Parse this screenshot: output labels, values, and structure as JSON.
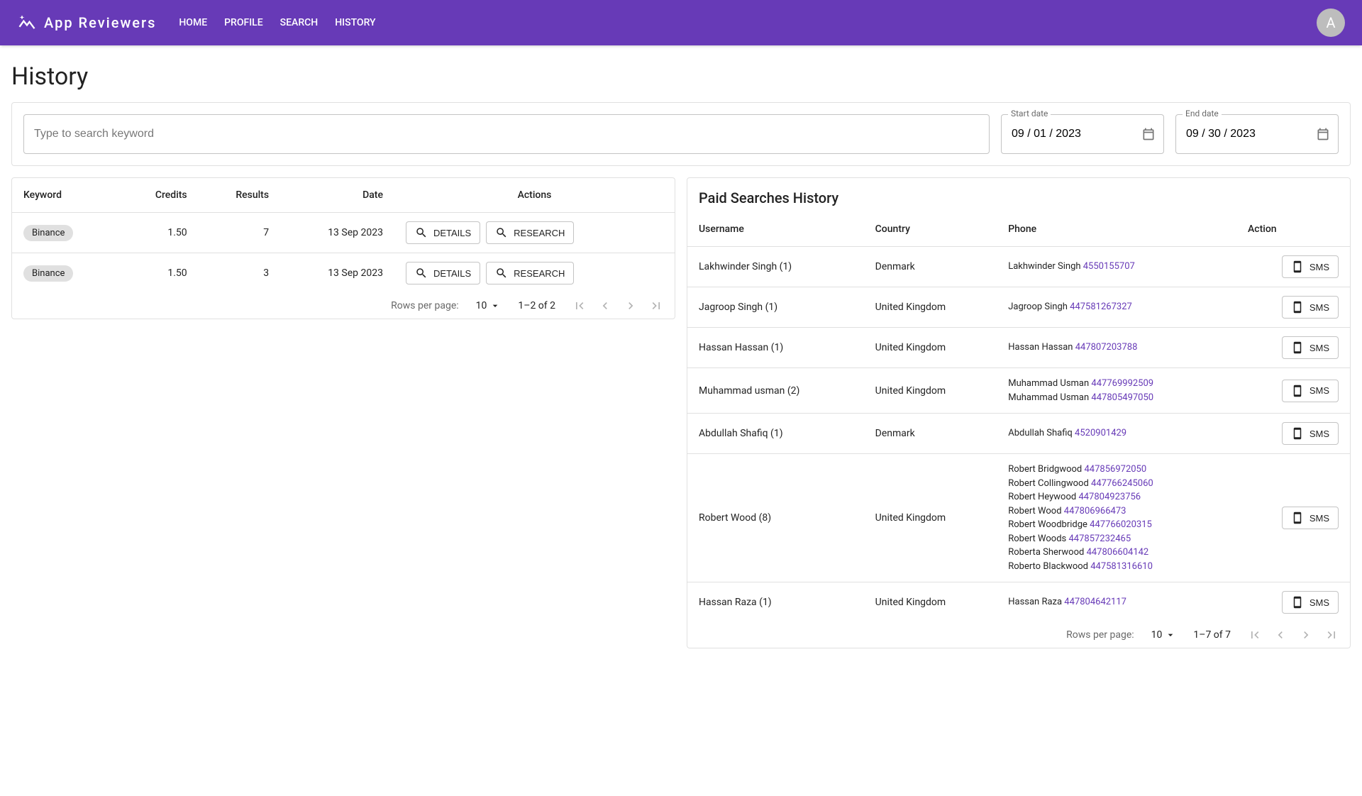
{
  "brand": {
    "name": "App Reviewers",
    "avatar_letter": "A"
  },
  "nav": [
    "HOME",
    "PROFILE",
    "SEARCH",
    "HISTORY"
  ],
  "page_title": "History",
  "filter": {
    "search_placeholder": "Type to search keyword",
    "start_label": "Start date",
    "start_value": "09 / 01 / 2023",
    "end_label": "End date",
    "end_value": "09 / 30 / 2023"
  },
  "left_table": {
    "headers": [
      "Keyword",
      "Credits",
      "Results",
      "Date",
      "Actions"
    ],
    "rows": [
      {
        "keyword": "Binance",
        "credits": "1.50",
        "results": "7",
        "date": "13 Sep 2023"
      },
      {
        "keyword": "Binance",
        "credits": "1.50",
        "results": "3",
        "date": "13 Sep 2023"
      }
    ],
    "action_labels": {
      "details": "DETAILS",
      "research": "RESEARCH"
    },
    "pager": {
      "per_page_label": "Rows per page:",
      "per_page_value": "10",
      "range": "1–2 of 2"
    }
  },
  "right_table": {
    "title": "Paid Searches History",
    "headers": [
      "Username",
      "Country",
      "Phone",
      "Action"
    ],
    "rows": [
      {
        "username": "Lakhwinder Singh (1)",
        "country": "Denmark",
        "phones": [
          {
            "name": "Lakhwinder Singh",
            "num": "4550155707"
          }
        ]
      },
      {
        "username": "Jagroop Singh (1)",
        "country": "United Kingdom",
        "phones": [
          {
            "name": "Jagroop Singh",
            "num": "447581267327"
          }
        ]
      },
      {
        "username": "Hassan Hassan (1)",
        "country": "United Kingdom",
        "phones": [
          {
            "name": "Hassan Hassan",
            "num": "447807203788"
          }
        ]
      },
      {
        "username": "Muhammad usman (2)",
        "country": "United Kingdom",
        "phones": [
          {
            "name": "Muhammad Usman",
            "num": "447769992509"
          },
          {
            "name": "Muhammad Usman",
            "num": "447805497050"
          }
        ]
      },
      {
        "username": "Abdullah Shafiq (1)",
        "country": "Denmark",
        "phones": [
          {
            "name": "Abdullah Shafiq",
            "num": "4520901429"
          }
        ]
      },
      {
        "username": "Robert Wood (8)",
        "country": "United Kingdom",
        "phones": [
          {
            "name": "Robert Bridgwood",
            "num": "447856972050"
          },
          {
            "name": "Robert Collingwood",
            "num": "447766245060"
          },
          {
            "name": "Robert Heywood",
            "num": "447804923756"
          },
          {
            "name": "Robert Wood",
            "num": "447806966473"
          },
          {
            "name": "Robert Woodbridge",
            "num": "447766020315"
          },
          {
            "name": "Robert Woods",
            "num": "447857232465"
          },
          {
            "name": "Roberta Sherwood",
            "num": "447806604142"
          },
          {
            "name": "Roberto Blackwood",
            "num": "447581316610"
          }
        ]
      },
      {
        "username": "Hassan Raza (1)",
        "country": "United Kingdom",
        "phones": [
          {
            "name": "Hassan Raza",
            "num": "447804642117"
          }
        ]
      }
    ],
    "sms_label": "SMS",
    "pager": {
      "per_page_label": "Rows per page:",
      "per_page_value": "10",
      "range": "1–7 of 7"
    }
  }
}
